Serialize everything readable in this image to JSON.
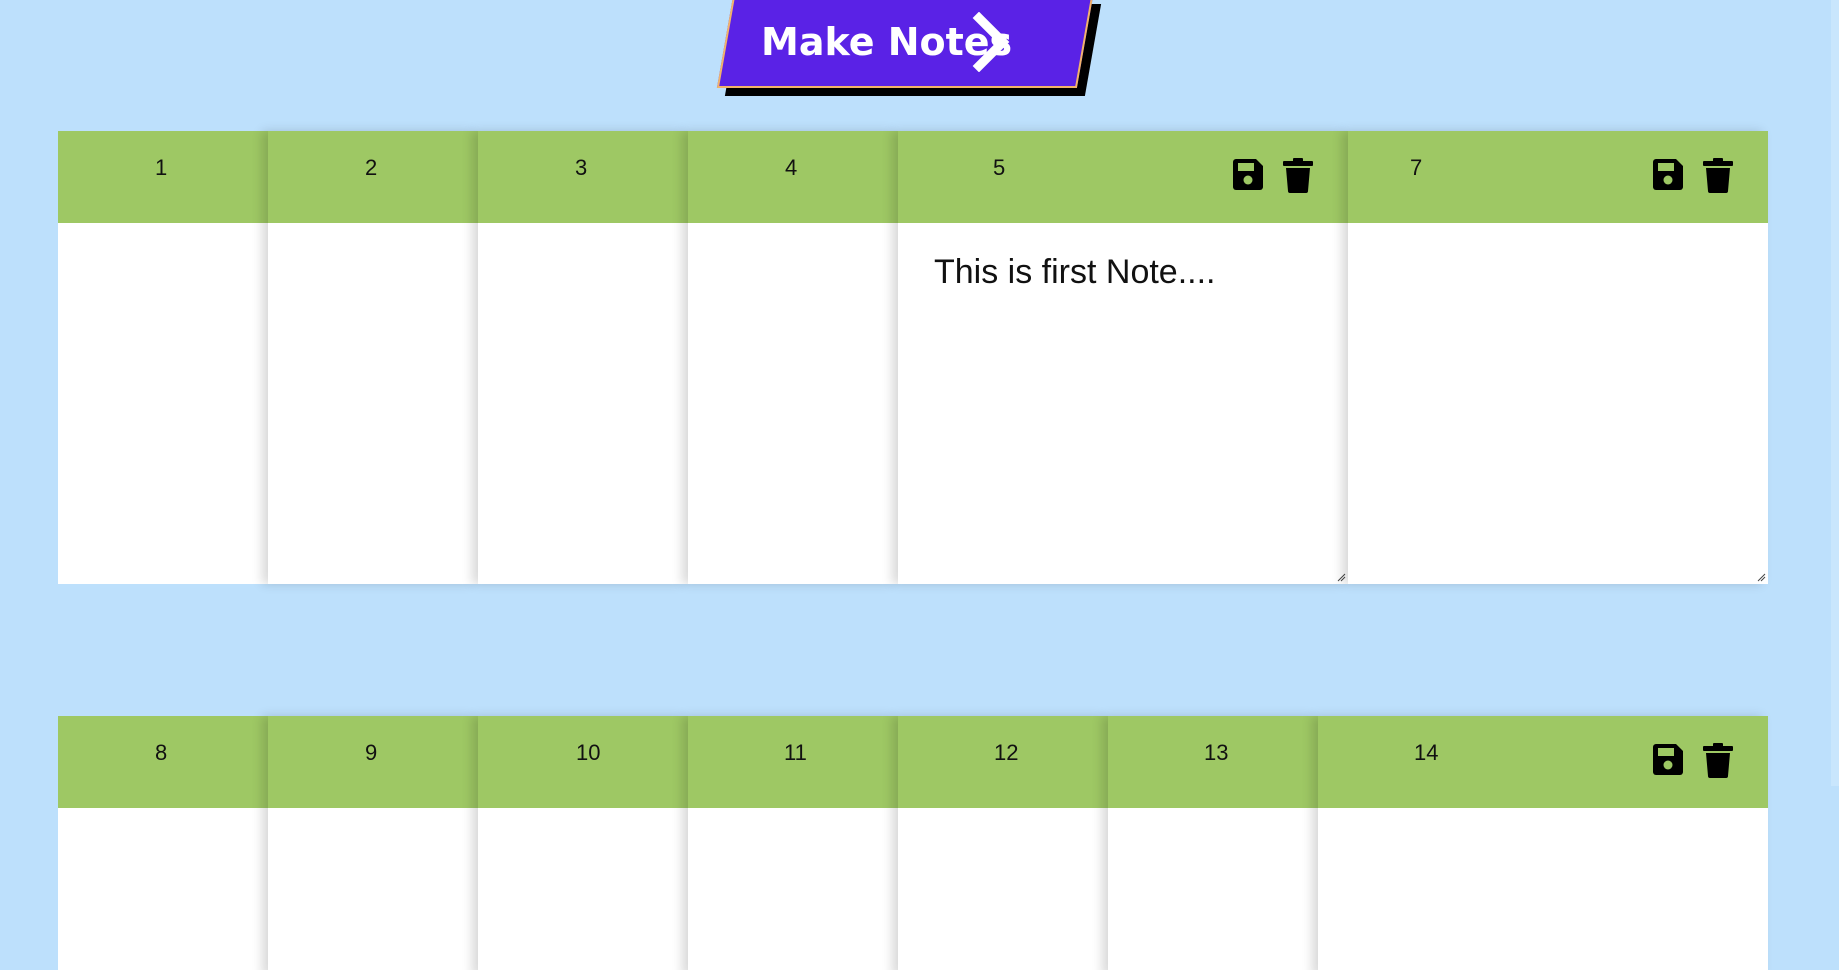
{
  "header": {
    "make_notes_label": "Make Notes",
    "make_notes_color": "#5a22e6"
  },
  "colors": {
    "background": "#bde0fc",
    "note_header": "#9ec864",
    "note_body": "#ffffff"
  },
  "rows": [
    {
      "notes": [
        {
          "number": "1"
        },
        {
          "number": "2"
        },
        {
          "number": "3"
        },
        {
          "number": "4"
        },
        {
          "number": "5",
          "text": "This is first Note...."
        },
        {
          "number": "7"
        }
      ]
    },
    {
      "notes": [
        {
          "number": "8"
        },
        {
          "number": "9"
        },
        {
          "number": "10"
        },
        {
          "number": "11"
        },
        {
          "number": "12"
        },
        {
          "number": "13"
        },
        {
          "number": "14"
        }
      ]
    }
  ],
  "icons": {
    "save": "floppy-disk-icon",
    "delete": "trash-icon"
  }
}
